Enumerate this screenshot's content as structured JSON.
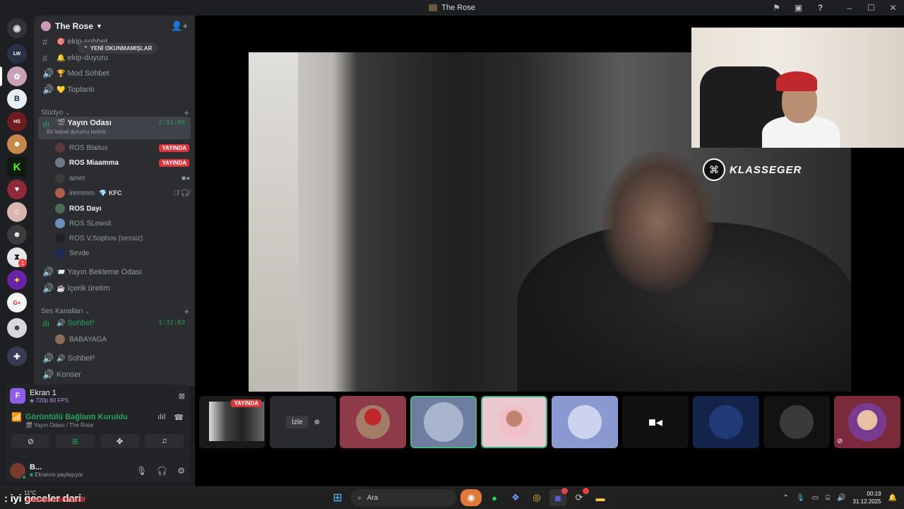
{
  "window": {
    "title": "The Rose"
  },
  "server": {
    "name": "The Rose"
  },
  "unread_pill": "YENİ OKUNMAMIŞLAR",
  "channels_top": [
    {
      "name": "ekip-sohbet",
      "emoji": "🎯"
    },
    {
      "name": "ekip-duyuru",
      "emoji": "🔔"
    },
    {
      "name": "Mod Sohbet",
      "emoji": "🏆"
    },
    {
      "name": "Toplantı",
      "emoji": "💛"
    }
  ],
  "category_studio": "Stüdyo",
  "yayin_odasi": {
    "name": "Yayın Odası",
    "time": "2:51:06",
    "status": "Bir kanal durumu belirle"
  },
  "voice_users": [
    {
      "name": "ROS Blaitus",
      "live": "YAYINDA",
      "bold": false
    },
    {
      "name": "ROS Miaamma",
      "live": "YAYINDA",
      "bold": true
    },
    {
      "name": "amet",
      "bold": false
    },
    {
      "name": "iremmm",
      "tag": "KFC",
      "bold": false
    },
    {
      "name": "ROS Dayı",
      "bold": true
    },
    {
      "name": "ROS SLewsit",
      "bold": false
    },
    {
      "name": "ROS V.Sophos (sessiz)",
      "bold": false
    },
    {
      "name": "Sevde",
      "bold": false
    }
  ],
  "channels_mid": [
    {
      "name": "Yayın Bekleme Odası",
      "emoji": "📨"
    },
    {
      "name": "İçerik üretim",
      "emoji": "☕"
    }
  ],
  "category_voice": "Ses Kanalları",
  "sohbet1": {
    "name": "Sohbet¹",
    "time": "1:32:03"
  },
  "sohbet1_user": "BABAYAGA",
  "sohbet2": "Sohbet²",
  "konser": "Konser",
  "ekran": {
    "name": "Ekran 1",
    "quality": "720p 60 FPS"
  },
  "connection": {
    "status": "Görüntülü Bağlantı Kuruldu",
    "location": "Yayın Odası / The Rose"
  },
  "current_user": {
    "name": "B...",
    "status": "Ekranını paylaşıyor"
  },
  "watermark": "KLASSEGER",
  "strip": {
    "live_label": "YAYINDA",
    "watch_label": "İzle"
  },
  "chat_overlay": {
    "user": "masterazeehimself",
    "message": ": iyi geceler dari"
  },
  "weather": "11°C",
  "taskbar": {
    "search_placeholder": "Ara"
  },
  "clock": {
    "time": "00:19",
    "date": "31.12.2025"
  },
  "colors": {
    "green": "#23a55a",
    "live_red": "#da373c",
    "accent_purple": "#8f5ee8"
  }
}
